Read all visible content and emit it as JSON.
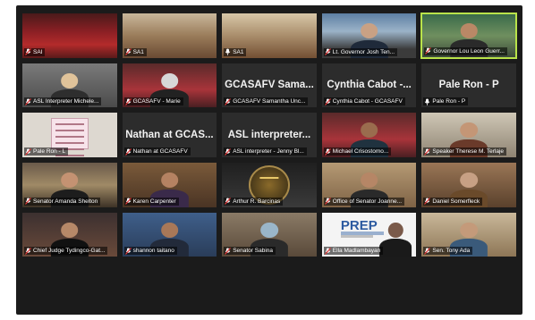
{
  "app": {
    "name": "Video meeting gallery view"
  },
  "colors": {
    "frame": "#1b1b1b",
    "tile": "#262626",
    "active_speaker": "#b9e34a",
    "muted_icon": "#e23b3b"
  },
  "tiles": [
    {
      "label": "SAI",
      "scene": "choir",
      "muted": true,
      "text_only": false,
      "person": null
    },
    {
      "label": "SA1",
      "scene": "church",
      "muted": true,
      "text_only": false,
      "person": null
    },
    {
      "label": "SA1",
      "scene": "church2",
      "muted": false,
      "text_only": false,
      "person": null
    },
    {
      "label": "Lt. Governor Josh Ten...",
      "scene": "office",
      "muted": true,
      "text_only": false,
      "person": "suit"
    },
    {
      "label": "Governor Lou Leon Guerr...",
      "scene": "green",
      "muted": true,
      "text_only": false,
      "person": "woman",
      "active": true
    },
    {
      "label": "ASL Interpreter Michele...",
      "scene": "gray",
      "muted": true,
      "text_only": false,
      "person": "blonde"
    },
    {
      "label": "GCASAFV - Marie",
      "scene": "red",
      "muted": true,
      "text_only": false,
      "person": "mask"
    },
    {
      "label": "GCASAFV Samantha Unc...",
      "scene": "",
      "muted": true,
      "text_only": true,
      "big": "GCASAFV Sama..."
    },
    {
      "label": "Cynthia Cabot - GCASAFV",
      "scene": "",
      "muted": true,
      "text_only": true,
      "big": "Cynthia Cabot -..."
    },
    {
      "label": "Pale Ron - P",
      "scene": "",
      "muted": false,
      "text_only": true,
      "big": "Pale Ron - P"
    },
    {
      "label": "Pale Ron - L",
      "scene": "doc",
      "muted": true,
      "text_only": false,
      "person": null
    },
    {
      "label": "Nathan at GCASAFV",
      "scene": "",
      "muted": true,
      "text_only": true,
      "big": "Nathan at GCAS..."
    },
    {
      "label": "ASL interpreter - Jenny Bl...",
      "scene": "",
      "muted": true,
      "text_only": true,
      "big": "ASL interpreter..."
    },
    {
      "label": "Michael Crisostomo...",
      "scene": "red",
      "muted": true,
      "text_only": false,
      "person": "man"
    },
    {
      "label": "Speaker Therese M. Terlaje",
      "scene": "light",
      "muted": true,
      "text_only": false,
      "person": "woman2"
    },
    {
      "label": "Senator Amanda Shelton",
      "scene": "flag",
      "muted": true,
      "text_only": false,
      "person": "woman3"
    },
    {
      "label": "Karen Carpenter",
      "scene": "books",
      "muted": true,
      "text_only": false,
      "person": "woman4"
    },
    {
      "label": "Arthur R. Barcinas",
      "scene": "seal",
      "muted": true,
      "text_only": false,
      "person": null
    },
    {
      "label": "Office of Senator Joanne...",
      "scene": "shelf",
      "muted": true,
      "text_only": false,
      "person": "woman5"
    },
    {
      "label": "Daniel Somerfleck",
      "scene": "wood",
      "muted": true,
      "text_only": false,
      "person": "man2"
    },
    {
      "label": "Chief Judge Tydingco-Gat...",
      "scene": "court",
      "muted": true,
      "text_only": false,
      "person": "judge"
    },
    {
      "label": "shannon taitano",
      "scene": "blue",
      "muted": true,
      "text_only": false,
      "person": "woman6"
    },
    {
      "label": "Senator Sabina",
      "scene": "room",
      "muted": true,
      "text_only": false,
      "person": "mask2"
    },
    {
      "label": "Ella Madlambayan",
      "scene": "prep",
      "muted": true,
      "text_only": false,
      "person": "woman7",
      "logo": "PREP"
    },
    {
      "label": "Sen. Tony Ada",
      "scene": "library",
      "muted": true,
      "text_only": false,
      "person": "man3"
    }
  ]
}
